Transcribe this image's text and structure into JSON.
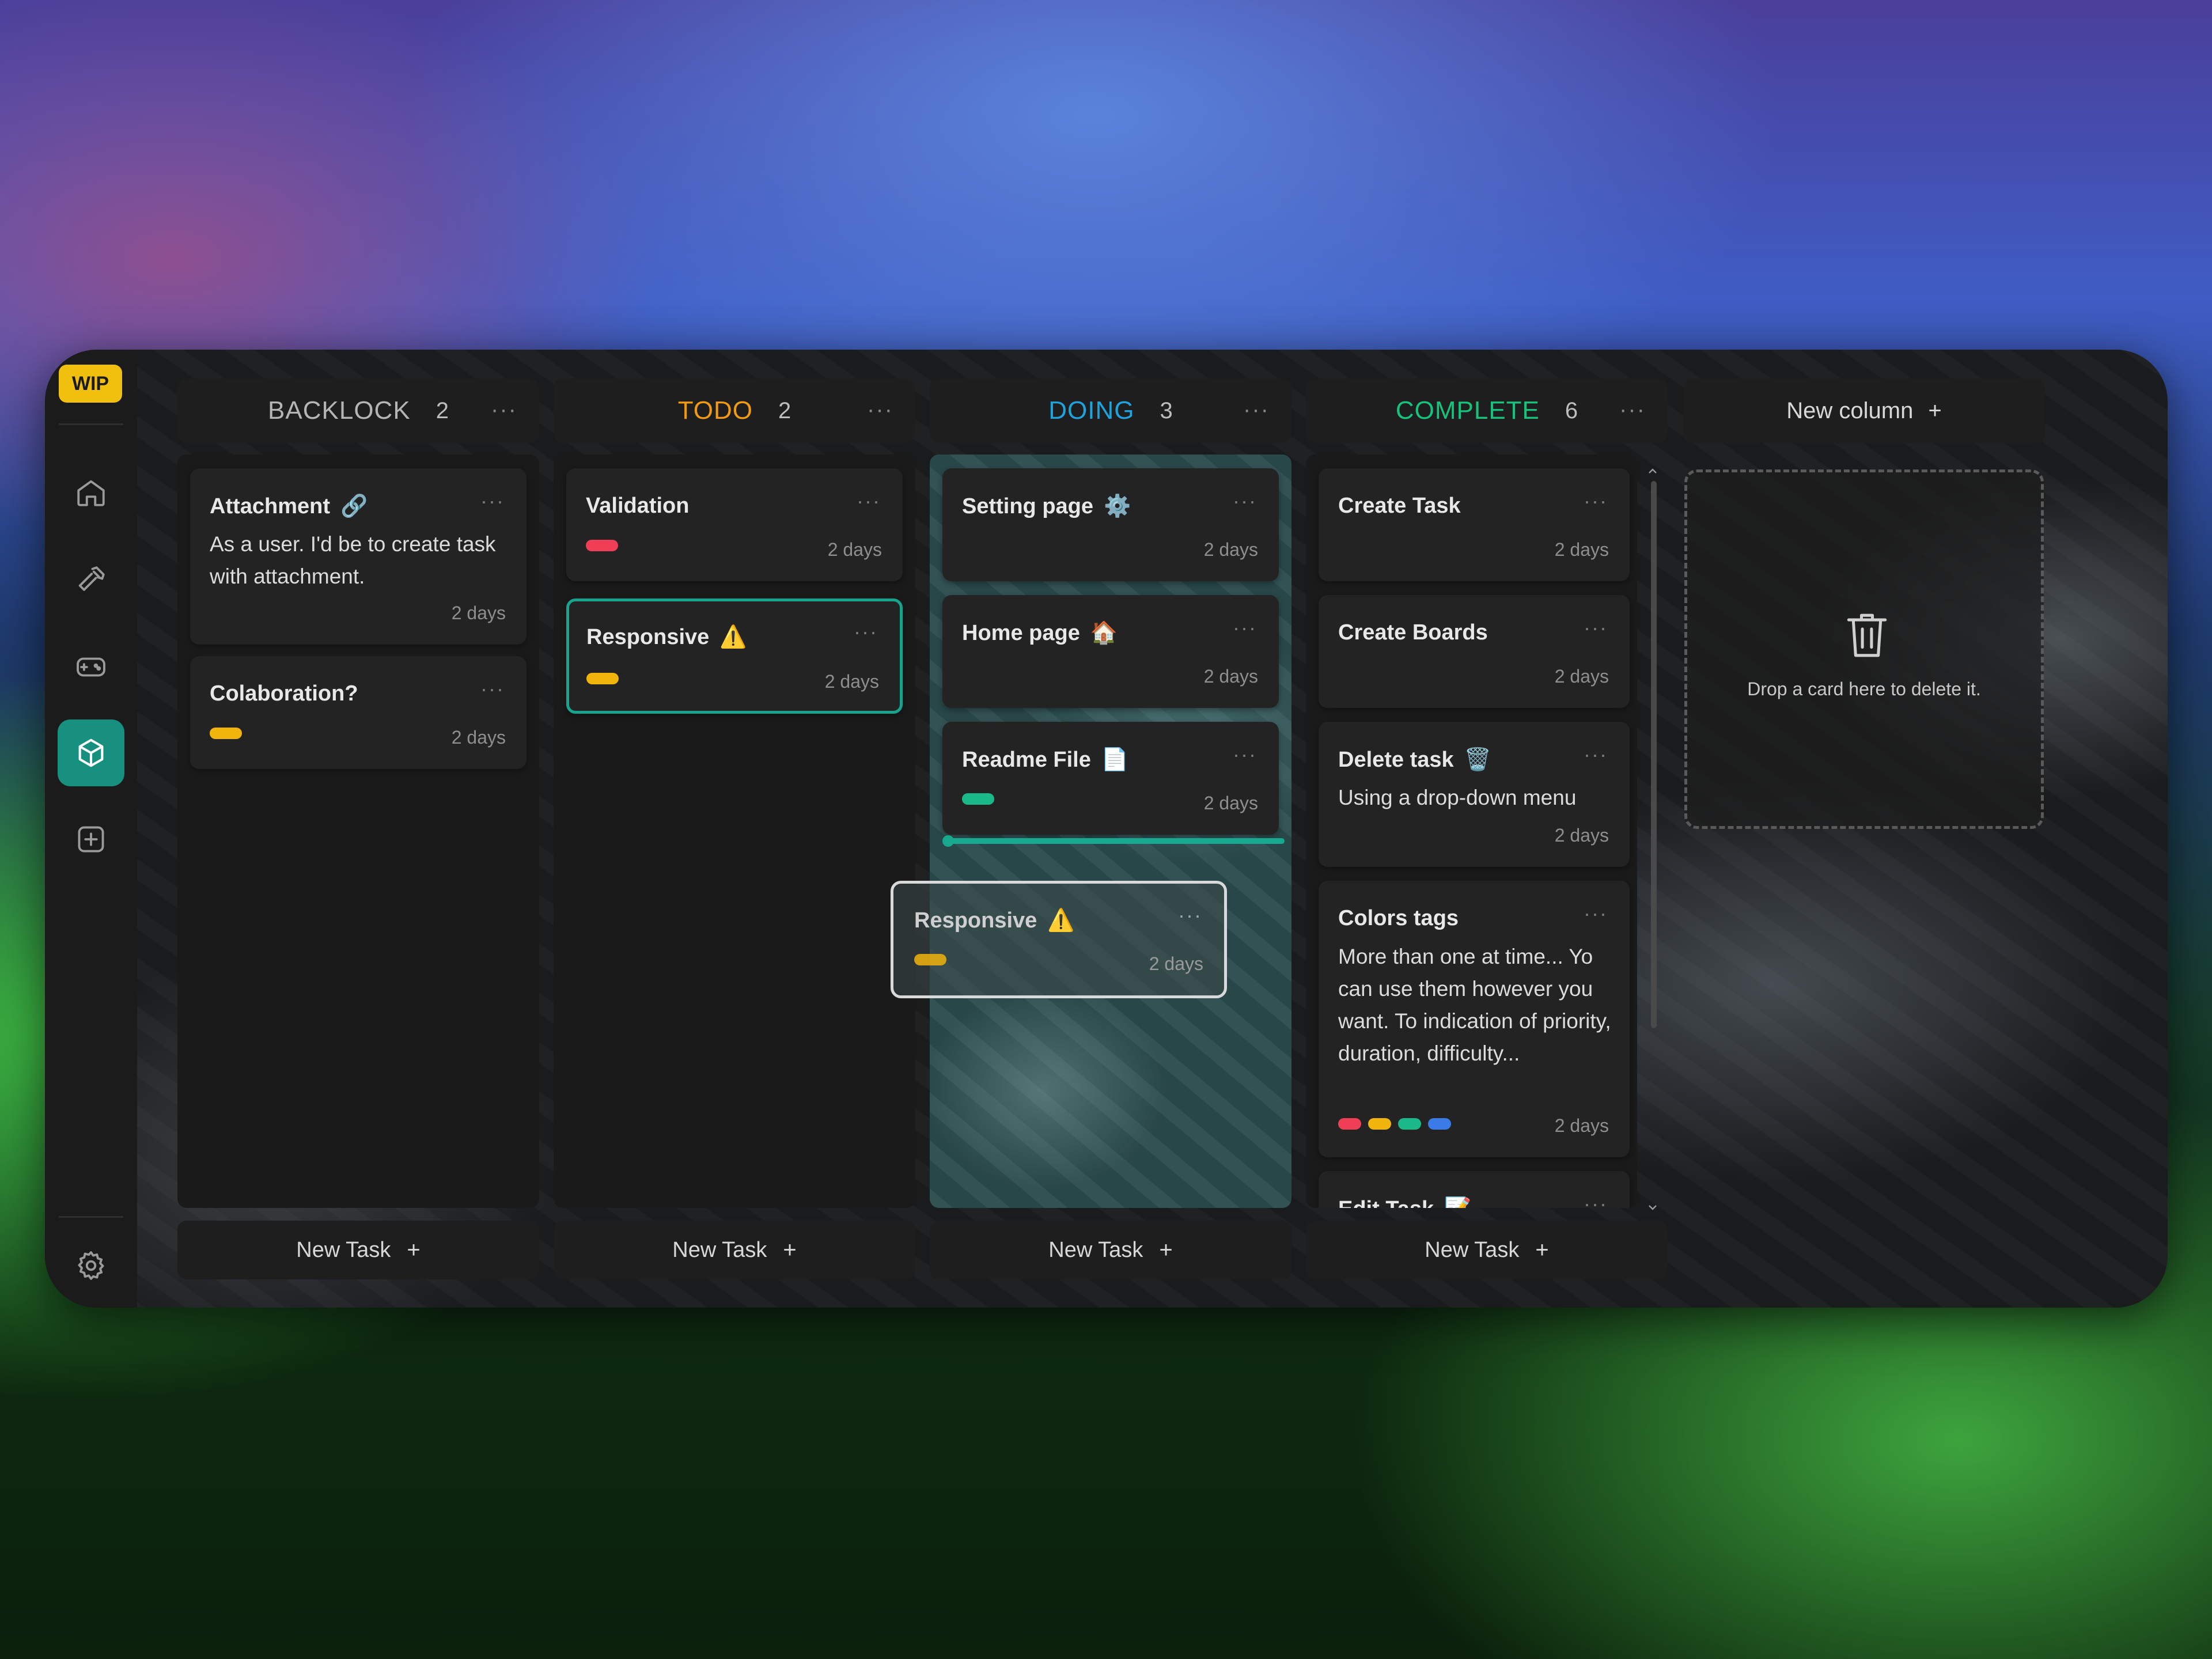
{
  "app": {
    "badge": "WIP"
  },
  "colors": {
    "backlog": "#b5b5b5",
    "todo": "#f29a11",
    "doing": "#1ea3dc",
    "complete": "#17c37b",
    "accent": "#17907f",
    "tag_red": "#ef3e56",
    "tag_yellow": "#f0b40c",
    "tag_green": "#1bb98a",
    "tag_blue": "#3a7be8"
  },
  "sidebar": {
    "items": [
      {
        "icon": "home-icon",
        "active": false
      },
      {
        "icon": "hammer-icon",
        "active": false
      },
      {
        "icon": "gamepad-icon",
        "active": false
      },
      {
        "icon": "cube-icon",
        "active": true
      },
      {
        "icon": "add-board-icon",
        "active": false
      }
    ],
    "settings_icon": "gear-icon"
  },
  "columns": [
    {
      "title": "BACKLOCK",
      "count": "2",
      "new_task": "New Task",
      "plus": "+",
      "cards": [
        {
          "title": "Attachment",
          "emoji": "🔗",
          "desc": "As a user. I'd be to create task with attachment.",
          "days": "2 days"
        },
        {
          "title": "Colaboration?",
          "tags": [
            "yellow"
          ],
          "days": "2 days"
        }
      ]
    },
    {
      "title": "TODO",
      "count": "2",
      "new_task": "New Task",
      "plus": "+",
      "cards": [
        {
          "title": "Validation",
          "tags": [
            "red"
          ],
          "days": "2 days"
        },
        {
          "title": "Responsive",
          "emoji": "⚠️",
          "tags": [
            "yellow"
          ],
          "days": "2 days",
          "selected": true
        }
      ]
    },
    {
      "title": "DOING",
      "count": "3",
      "new_task": "New Task",
      "plus": "+",
      "cards": [
        {
          "title": "Setting page",
          "emoji": "⚙️",
          "days": "2 days"
        },
        {
          "title": "Home page",
          "emoji": "🏠",
          "days": "2 days"
        },
        {
          "title": "Readme File",
          "emoji": "📄",
          "tags": [
            "green"
          ],
          "days": "2 days"
        }
      ]
    },
    {
      "title": "COMPLETE",
      "count": "6",
      "new_task": "New Task",
      "plus": "+",
      "cards": [
        {
          "title": "Create Task",
          "days": "2 days"
        },
        {
          "title": "Create Boards",
          "days": "2 days"
        },
        {
          "title": "Delete task",
          "emoji": "🗑️",
          "desc": "Using a drop-down menu",
          "days": "2 days"
        },
        {
          "title": "Colors tags",
          "desc": "More than one at time... Yo can use them however you want. To indication of priority, duration, difficulty...",
          "tags": [
            "red",
            "yellow",
            "green",
            "blue"
          ],
          "days": "2 days"
        },
        {
          "title": "Edit Task",
          "emoji": "📝"
        }
      ]
    }
  ],
  "dragging_card": {
    "title": "Responsive",
    "emoji": "⚠️",
    "tags": [
      "yellow"
    ],
    "days": "2 days"
  },
  "card_menu": "···",
  "new_column": {
    "label": "New column",
    "plus": "+"
  },
  "drop_zone": {
    "text": "Drop a card here to delete it.",
    "icon": "trash-icon"
  }
}
